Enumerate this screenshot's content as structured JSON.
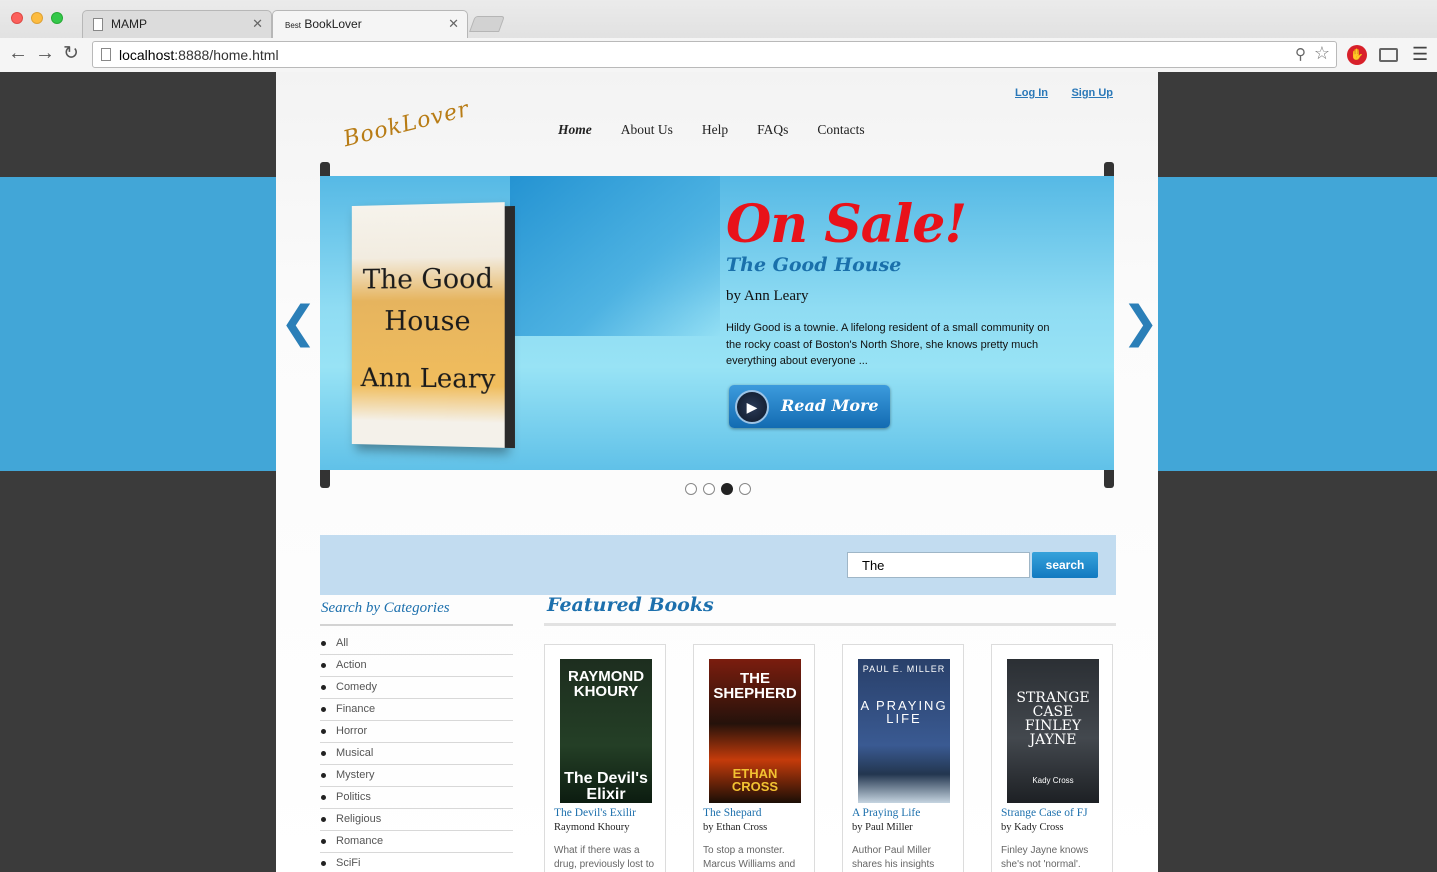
{
  "browser": {
    "tabs": [
      {
        "label": "MAMP"
      },
      {
        "label_small": "Best",
        "label": "BookLover"
      }
    ],
    "url_host": "localhost",
    "url_rest": ":8888/home.html"
  },
  "header": {
    "login": "Log In",
    "signup": "Sign Up",
    "logo": "BookLover",
    "nav": [
      "Home",
      "About Us",
      "Help",
      "FAQs",
      "Contacts"
    ]
  },
  "slider": {
    "heading": "On Sale!",
    "book_title": "The Good House",
    "author": "by Ann Leary",
    "description": "Hildy Good is a townie. A lifelong resident of a small community on the rocky coast of Boston's North Shore, she knows pretty much everything about everyone ...",
    "cta": "Read More",
    "cover": {
      "line1": "The Good",
      "line2": "House",
      "line3": "Ann Leary"
    },
    "dots": 4,
    "active_dot": 2
  },
  "search": {
    "value": "The",
    "button": "search"
  },
  "categories": {
    "title": "Search by Categories",
    "items": [
      "All",
      "Action",
      "Comedy",
      "Finance",
      "Horror",
      "Musical",
      "Mystery",
      "Politics",
      "Religious",
      "Romance",
      "SciFi"
    ]
  },
  "featured": {
    "title": "Featured Books",
    "books": [
      {
        "title": "The Devil's Exilir",
        "author": "Raymond Khoury",
        "desc": "What if there was a drug, previously lost to",
        "cover_top": "RAYMOND KHOURY",
        "cover_bottom": "The Devil's Elixir"
      },
      {
        "title": "The Shepard",
        "author": "by Ethan Cross",
        "desc": "To stop a monster. Marcus Williams and",
        "cover_top": "THE SHEPHERD",
        "cover_bottom": "ETHAN CROSS"
      },
      {
        "title": "A Praying Life",
        "author": "by Paul Miller",
        "desc": "Author Paul Miller shares his insights",
        "cover_top": "PAUL E. MILLER",
        "cover_bottom": "A PRAYING LIFE"
      },
      {
        "title": "Strange Case of FJ",
        "author": "by Kady Cross",
        "desc": "Finley Jayne knows she's not 'normal'.",
        "cover_top": "STRANGE CASE FINLEY JAYNE",
        "cover_bottom": "Kady Cross"
      }
    ]
  }
}
